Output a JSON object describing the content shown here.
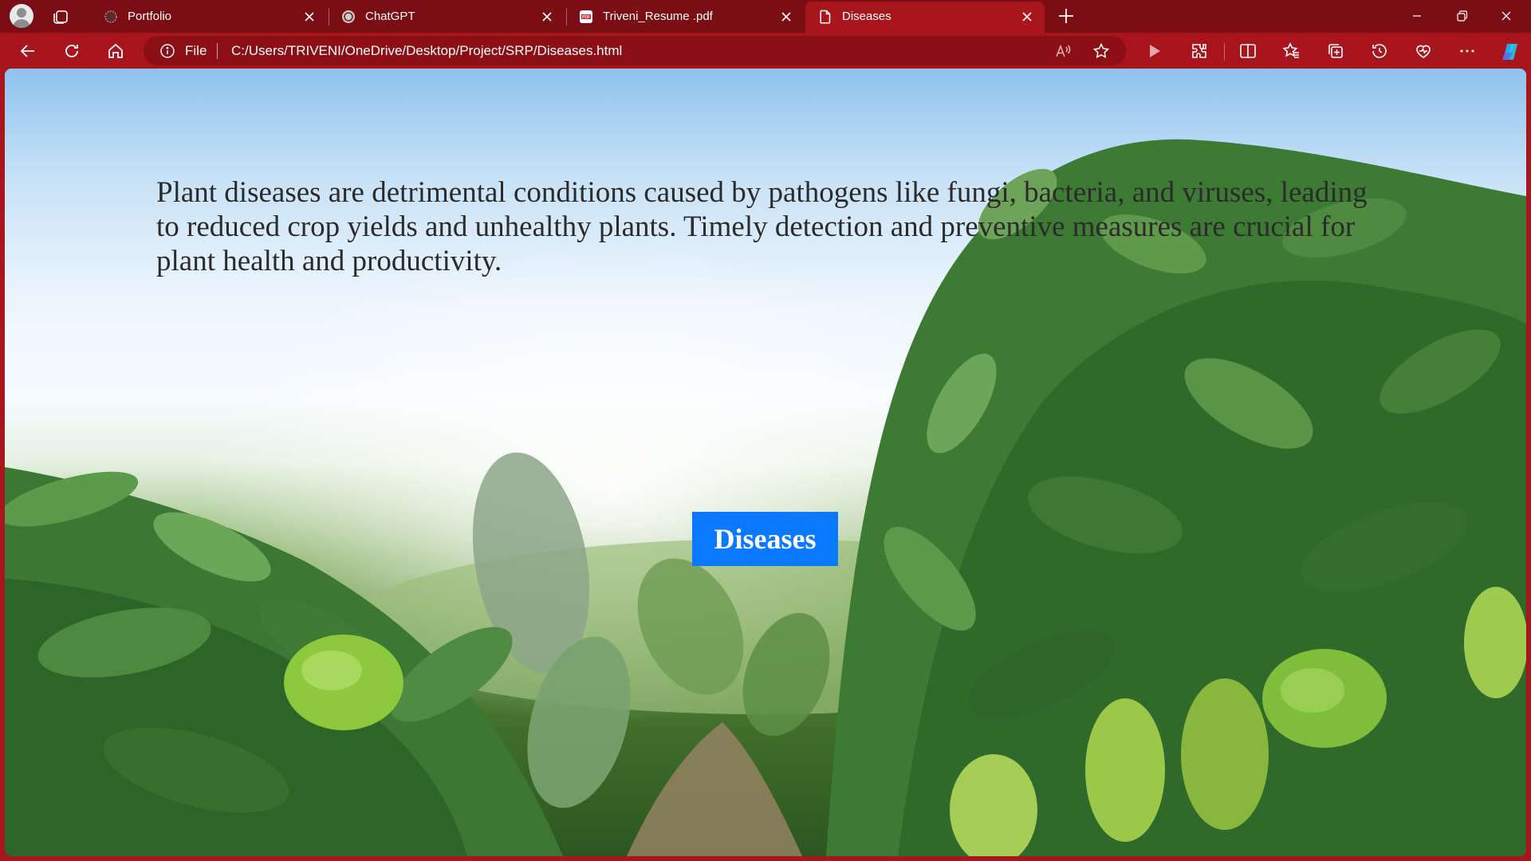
{
  "browser": {
    "tabs": [
      {
        "title": "Portfolio",
        "favicon": "portfolio-favicon-icon",
        "active": false
      },
      {
        "title": "ChatGPT",
        "favicon": "chatgpt-favicon-icon",
        "active": false
      },
      {
        "title": "Triveni_Resume .pdf",
        "favicon": "pdf-favicon-icon",
        "active": false
      },
      {
        "title": "Diseases",
        "favicon": "page-favicon-icon",
        "active": true
      }
    ],
    "address": {
      "scheme_label": "File",
      "url": "C:/Users/TRIVENI/OneDrive/Desktop/Project/SRP/Diseases.html"
    },
    "colors": {
      "frame": "#7b0e14",
      "toolbar": "#a8151d",
      "addressbar": "#8d0f16"
    }
  },
  "page": {
    "intro_text": "Plant diseases are detrimental conditions caused by pathogens like fungi, bacteria, and viruses, leading to reduced crop yields and unhealthy plants. Timely detection and preventive measures are crucial for plant health and productivity.",
    "diseases_button": "Diseases",
    "button_color": "#0a78ff"
  }
}
